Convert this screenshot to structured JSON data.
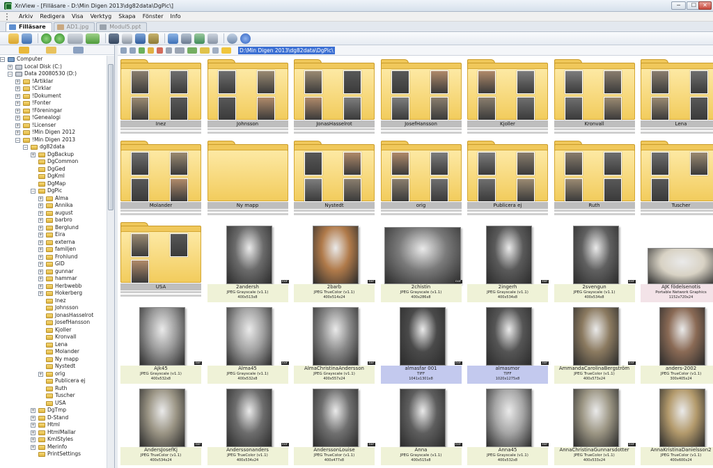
{
  "window": {
    "title": "XnView - [Filläsare - D:\\Min Digen 2013\\dg82data\\DgPic\\]",
    "controls": [
      "─",
      "☐",
      "✕"
    ]
  },
  "menu": [
    "Arkiv",
    "Redigera",
    "Visa",
    "Verktyg",
    "Skapa",
    "Fönster",
    "Info"
  ],
  "tabs": [
    {
      "label": "Filläsare",
      "active": true
    },
    {
      "label": "AD1.jpg",
      "active": false
    },
    {
      "label": "Modul5.ppt",
      "active": false
    }
  ],
  "address": {
    "path": "D:\\Min Digen 2013\\dg82data\\DgPic\\"
  },
  "tree": [
    {
      "label": "Computer",
      "depth": 0,
      "exp": "−",
      "icon": "pc"
    },
    {
      "label": "Local Disk (C:)",
      "depth": 1,
      "exp": "+",
      "icon": "disk"
    },
    {
      "label": "Data 20080530 (D:)",
      "depth": 1,
      "exp": "−",
      "icon": "disk"
    },
    {
      "label": "!Artiklar",
      "depth": 2,
      "exp": "+"
    },
    {
      "label": "!Cirklar",
      "depth": 2,
      "exp": "+"
    },
    {
      "label": "!Dokument",
      "depth": 2,
      "exp": "+"
    },
    {
      "label": "!Fonter",
      "depth": 2,
      "exp": "+"
    },
    {
      "label": "!Föreningar",
      "depth": 2,
      "exp": "+"
    },
    {
      "label": "!Genealogi",
      "depth": 2,
      "exp": "+"
    },
    {
      "label": "!Licenser",
      "depth": 2,
      "exp": "+"
    },
    {
      "label": "!Min Digen 2012",
      "depth": 2,
      "exp": "+"
    },
    {
      "label": "!Min Digen 2013",
      "depth": 2,
      "exp": "−"
    },
    {
      "label": "dg82data",
      "depth": 3,
      "exp": "−"
    },
    {
      "label": "DgBackup",
      "depth": 4,
      "exp": "+"
    },
    {
      "label": "DgCommon",
      "depth": 4,
      "exp": ""
    },
    {
      "label": "DgGed",
      "depth": 4,
      "exp": ""
    },
    {
      "label": "DgKml",
      "depth": 4,
      "exp": ""
    },
    {
      "label": "DgMap",
      "depth": 4,
      "exp": ""
    },
    {
      "label": "DgPic",
      "depth": 4,
      "exp": "−"
    },
    {
      "label": "Alma",
      "depth": 5,
      "exp": "+"
    },
    {
      "label": "Annika",
      "depth": 5,
      "exp": "+"
    },
    {
      "label": "august",
      "depth": 5,
      "exp": "+"
    },
    {
      "label": "barbro",
      "depth": 5,
      "exp": "+"
    },
    {
      "label": "Berglund",
      "depth": 5,
      "exp": "+"
    },
    {
      "label": "Eira",
      "depth": 5,
      "exp": "+"
    },
    {
      "label": "externa",
      "depth": 5,
      "exp": "+"
    },
    {
      "label": "familjen",
      "depth": 5,
      "exp": "+"
    },
    {
      "label": "Frohlund",
      "depth": 5,
      "exp": "+"
    },
    {
      "label": "GID",
      "depth": 5,
      "exp": "+"
    },
    {
      "label": "gunnar",
      "depth": 5,
      "exp": "+"
    },
    {
      "label": "hammar",
      "depth": 5,
      "exp": "+"
    },
    {
      "label": "Herbwebb",
      "depth": 5,
      "exp": "+"
    },
    {
      "label": "Hokerberg",
      "depth": 5,
      "exp": "+"
    },
    {
      "label": "Inez",
      "depth": 5,
      "exp": ""
    },
    {
      "label": "Johnsson",
      "depth": 5,
      "exp": ""
    },
    {
      "label": "JonasHasselrot",
      "depth": 5,
      "exp": ""
    },
    {
      "label": "JosefHansson",
      "depth": 5,
      "exp": ""
    },
    {
      "label": "Kjoller",
      "depth": 5,
      "exp": ""
    },
    {
      "label": "Kronvall",
      "depth": 5,
      "exp": ""
    },
    {
      "label": "Lena",
      "depth": 5,
      "exp": ""
    },
    {
      "label": "Molander",
      "depth": 5,
      "exp": ""
    },
    {
      "label": "Ny mapp",
      "depth": 5,
      "exp": ""
    },
    {
      "label": "Nystedt",
      "depth": 5,
      "exp": ""
    },
    {
      "label": "orig",
      "depth": 5,
      "exp": "+"
    },
    {
      "label": "Publicera ej",
      "depth": 5,
      "exp": ""
    },
    {
      "label": "Ruth",
      "depth": 5,
      "exp": ""
    },
    {
      "label": "Tuscher",
      "depth": 5,
      "exp": ""
    },
    {
      "label": "USA",
      "depth": 5,
      "exp": ""
    },
    {
      "label": "DgTmp",
      "depth": 4,
      "exp": "+"
    },
    {
      "label": "D-Stand",
      "depth": 4,
      "exp": "+"
    },
    {
      "label": "Html",
      "depth": 4,
      "exp": "+"
    },
    {
      "label": "HtmlMallar",
      "depth": 4,
      "exp": "+"
    },
    {
      "label": "KmlStyles",
      "depth": 4,
      "exp": "+"
    },
    {
      "label": "Merinfo",
      "depth": 4,
      "exp": "+"
    },
    {
      "label": "PrintSettings",
      "depth": 4,
      "exp": ""
    }
  ],
  "folders": [
    {
      "name": "Inez",
      "thumbs": 4
    },
    {
      "name": "Johnsson",
      "thumbs": 4
    },
    {
      "name": "JonasHasselrot",
      "thumbs": 4
    },
    {
      "name": "JosefHansson",
      "thumbs": 4
    },
    {
      "name": "Kjoller",
      "thumbs": 4
    },
    {
      "name": "Kronvall",
      "thumbs": 4
    },
    {
      "name": "Lena",
      "thumbs": 4
    },
    {
      "name": "Molander",
      "thumbs": 4
    },
    {
      "name": "Ny mapp",
      "thumbs": 0
    },
    {
      "name": "Nystedt",
      "thumbs": 4
    },
    {
      "name": "orig",
      "thumbs": 4
    },
    {
      "name": "Publicera ej",
      "thumbs": 4
    },
    {
      "name": "Ruth",
      "thumbs": 4
    },
    {
      "name": "Tuscher",
      "thumbs": 3
    },
    {
      "name": "USA",
      "thumbs": 3
    }
  ],
  "files": [
    {
      "name": "2andersh",
      "type": "JPEG Grayscale (v1.1)",
      "dims": "400x513x8",
      "tone": "#6b6b6b",
      "exif": true
    },
    {
      "name": "2barb",
      "type": "JPEG TrueColor (v1.1)",
      "dims": "400x514x24",
      "tone": "#b07a4a",
      "exif": true
    },
    {
      "name": "2chistin",
      "type": "JPEG Grayscale (v1.1)",
      "dims": "400x286x8",
      "tone": "#7a7a7a",
      "exif": true
    },
    {
      "name": "2ingerh",
      "type": "JPEG Grayscale (v1.1)",
      "dims": "400x534x8",
      "tone": "#5a5a5a",
      "exif": true
    },
    {
      "name": "2svengun",
      "type": "JPEG Grayscale (v1.1)",
      "dims": "400x534x8",
      "tone": "#606060",
      "exif": true
    },
    {
      "name": "AJK födelsenotis",
      "type": "Portable Network Graphics",
      "dims": "1152x720x24",
      "tone": "#d8d2c4",
      "exif": false,
      "style": "pink"
    },
    {
      "name": "Ajk45",
      "type": "JPEG Grayscale (v1.1)",
      "dims": "400x532x8",
      "tone": "#9a9a9a",
      "exif": true
    },
    {
      "name": "Alma45",
      "type": "JPEG Grayscale (v1.1)",
      "dims": "400x532x8",
      "tone": "#a0a0a0",
      "exif": true
    },
    {
      "name": "AlmaChristinaAndersson",
      "type": "JPEG Grayscale (v1.1)",
      "dims": "400x557x24",
      "tone": "#8a8a8a",
      "exif": true
    },
    {
      "name": "almasfar 001",
      "type": "TIFF",
      "dims": "1041x1301x8",
      "tone": "#4a4a4a",
      "exif": true,
      "style": "sel"
    },
    {
      "name": "almasmor",
      "type": "TIFF",
      "dims": "1020x1275x8",
      "tone": "#555555",
      "exif": true,
      "style": "sel"
    },
    {
      "name": "AmmandaCarolinaBergström",
      "type": "JPEG TrueColor (v1.1)",
      "dims": "400x573x24",
      "tone": "#8b7a60",
      "exif": true
    },
    {
      "name": "anders-2002",
      "type": "JPEG TrueColor (v1.1)",
      "dims": "300x405x24",
      "tone": "#8a6a55",
      "exif": true
    },
    {
      "name": "AndersJosefKj",
      "type": "JPEG TrueColor (v1.1)",
      "dims": "400x534x24",
      "tone": "#9b9585",
      "exif": true
    },
    {
      "name": "Anderssonanders",
      "type": "JPEG TrueColor (v1.1)",
      "dims": "400x534x24",
      "tone": "#6d6d6d",
      "exif": true
    },
    {
      "name": "AnderssonLouise",
      "type": "JPEG TrueColor (v1.1)",
      "dims": "400x477x8",
      "tone": "#707070",
      "exif": true
    },
    {
      "name": "Anna",
      "type": "JPEG Grayscale (v1.1)",
      "dims": "400x515x8",
      "tone": "#5e5e5e",
      "exif": true
    },
    {
      "name": "Anna45",
      "type": "JPEG Grayscale (v1.1)",
      "dims": "400x532x8",
      "tone": "#a5a5a5",
      "exif": true
    },
    {
      "name": "AnnaChristinaGunnarsdotter",
      "type": "JPEG TrueColor (v1.1)",
      "dims": "400x533x24",
      "tone": "#9c9684",
      "exif": true
    },
    {
      "name": "AnnaKristinaDanielsson2",
      "type": "JPEG TrueColor (v1.1)",
      "dims": "400x600x24",
      "tone": "#b39a6c",
      "exif": true
    }
  ],
  "colors": {
    "folder": "#f0c85b",
    "selection": "#3b6fd3",
    "info_bg": "#eff2d7",
    "info_sel": "#c3c9ee"
  }
}
